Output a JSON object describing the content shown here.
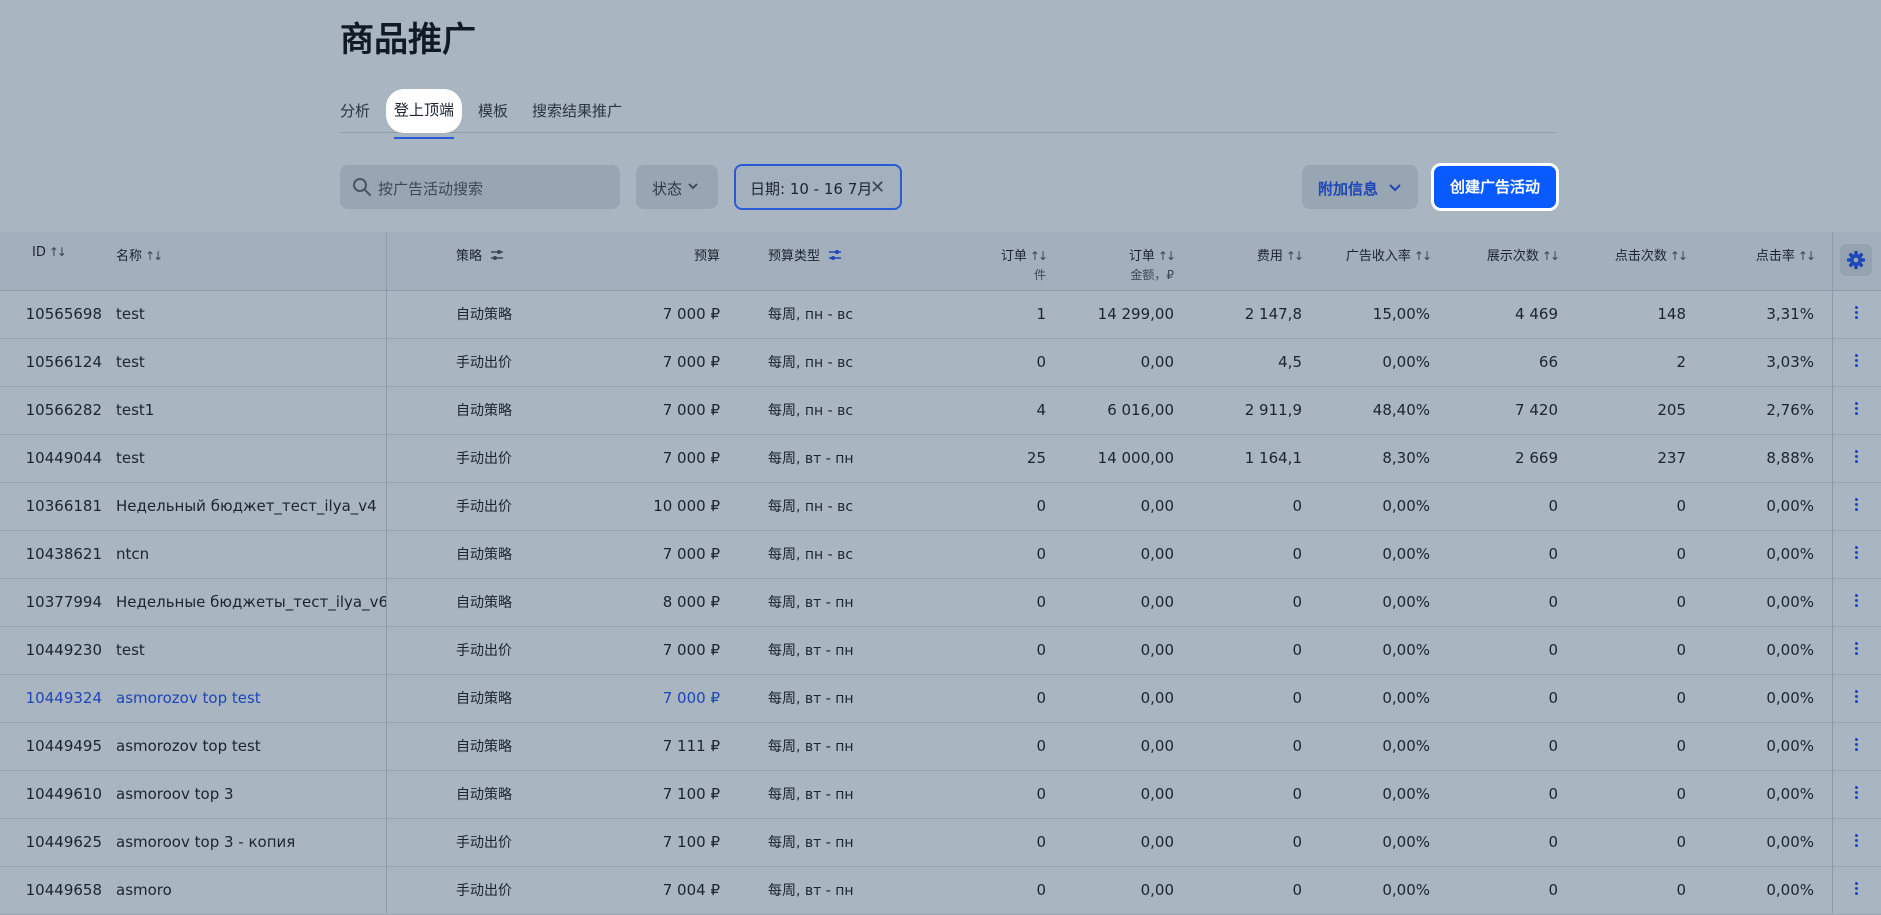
{
  "page": {
    "title": "商品推广"
  },
  "tabs": [
    {
      "label": "分析"
    },
    {
      "label": "登上顶端"
    },
    {
      "label": "模板"
    },
    {
      "label": "搜索结果推广"
    }
  ],
  "toolbar": {
    "search_placeholder": "按广告活动搜索",
    "status_label": "状态",
    "date_chip": "日期: 10 - 16 7月",
    "extra_info_label": "附加信息",
    "create_label": "创建广告活动"
  },
  "table": {
    "columns": [
      {
        "label": "ID"
      },
      {
        "label": "名称"
      },
      {
        "label": "策略"
      },
      {
        "label": "预算"
      },
      {
        "label": "预算类型"
      },
      {
        "label": "订单",
        "sub": "件"
      },
      {
        "label": "订单",
        "sub": "金额，₽"
      },
      {
        "label": "费用"
      },
      {
        "label": "广告收入率"
      },
      {
        "label": "展示次数"
      },
      {
        "label": "点击次数"
      },
      {
        "label": "点击率"
      }
    ],
    "rows": [
      {
        "id": "10565698",
        "name": "test",
        "strategy": "自动策略",
        "budget": "7 000 ₽",
        "budget_type": "每周, пн - вс",
        "orders": "1",
        "orders_sum": "14 299,00",
        "cost": "2 147,8",
        "ad_rate": "15,00%",
        "impressions": "4 469",
        "clicks": "148",
        "ctr": "3,31%"
      },
      {
        "id": "10566124",
        "name": "test",
        "strategy": "手动出价",
        "budget": "7 000 ₽",
        "budget_type": "每周, пн - вс",
        "orders": "0",
        "orders_sum": "0,00",
        "cost": "4,5",
        "ad_rate": "0,00%",
        "impressions": "66",
        "clicks": "2",
        "ctr": "3,03%"
      },
      {
        "id": "10566282",
        "name": "test1",
        "strategy": "自动策略",
        "budget": "7 000 ₽",
        "budget_type": "每周, пн - вс",
        "orders": "4",
        "orders_sum": "6 016,00",
        "cost": "2 911,9",
        "ad_rate": "48,40%",
        "impressions": "7 420",
        "clicks": "205",
        "ctr": "2,76%"
      },
      {
        "id": "10449044",
        "name": "test",
        "strategy": "手动出价",
        "budget": "7 000 ₽",
        "budget_type": "每周, вт - пн",
        "orders": "25",
        "orders_sum": "14 000,00",
        "cost": "1 164,1",
        "ad_rate": "8,30%",
        "impressions": "2 669",
        "clicks": "237",
        "ctr": "8,88%"
      },
      {
        "id": "10366181",
        "name": "Недельный бюджет_тест_ilya_v4",
        "strategy": "手动出价",
        "budget": "10 000 ₽",
        "budget_type": "每周, пн - вс",
        "orders": "0",
        "orders_sum": "0,00",
        "cost": "0",
        "ad_rate": "0,00%",
        "impressions": "0",
        "clicks": "0",
        "ctr": "0,00%"
      },
      {
        "id": "10438621",
        "name": "ntcn",
        "strategy": "自动策略",
        "budget": "7 000 ₽",
        "budget_type": "每周, пн - вс",
        "orders": "0",
        "orders_sum": "0,00",
        "cost": "0",
        "ad_rate": "0,00%",
        "impressions": "0",
        "clicks": "0",
        "ctr": "0,00%"
      },
      {
        "id": "10377994",
        "name": "Недельные бюджеты_тест_ilya_v6",
        "strategy": "自动策略",
        "budget": "8 000 ₽",
        "budget_type": "每周, вт - пн",
        "orders": "0",
        "orders_sum": "0,00",
        "cost": "0",
        "ad_rate": "0,00%",
        "impressions": "0",
        "clicks": "0",
        "ctr": "0,00%"
      },
      {
        "id": "10449230",
        "name": "test",
        "strategy": "手动出价",
        "budget": "7 000 ₽",
        "budget_type": "每周, вт - пн",
        "orders": "0",
        "orders_sum": "0,00",
        "cost": "0",
        "ad_rate": "0,00%",
        "impressions": "0",
        "clicks": "0",
        "ctr": "0,00%"
      },
      {
        "id": "10449324",
        "name": "asmorozov top test",
        "strategy": "自动策略",
        "budget": "7 000 ₽",
        "budget_type": "每周, вт - пн",
        "orders": "0",
        "orders_sum": "0,00",
        "cost": "0",
        "ad_rate": "0,00%",
        "impressions": "0",
        "clicks": "0",
        "ctr": "0,00%",
        "highlight": true
      },
      {
        "id": "10449495",
        "name": "asmorozov top test",
        "strategy": "自动策略",
        "budget": "7 111 ₽",
        "budget_type": "每周, вт - пн",
        "orders": "0",
        "orders_sum": "0,00",
        "cost": "0",
        "ad_rate": "0,00%",
        "impressions": "0",
        "clicks": "0",
        "ctr": "0,00%"
      },
      {
        "id": "10449610",
        "name": "asmoroov top 3",
        "strategy": "自动策略",
        "budget": "7 100 ₽",
        "budget_type": "每周, вт - пн",
        "orders": "0",
        "orders_sum": "0,00",
        "cost": "0",
        "ad_rate": "0,00%",
        "impressions": "0",
        "clicks": "0",
        "ctr": "0,00%"
      },
      {
        "id": "10449625",
        "name": "asmoroov top 3 - копия",
        "strategy": "手动出价",
        "budget": "7 100 ₽",
        "budget_type": "每周, вт - пн",
        "orders": "0",
        "orders_sum": "0,00",
        "cost": "0",
        "ad_rate": "0,00%",
        "impressions": "0",
        "clicks": "0",
        "ctr": "0,00%"
      },
      {
        "id": "10449658",
        "name": "asmoro",
        "strategy": "手动出价",
        "budget": "7 004 ₽",
        "budget_type": "每周, вт - пн",
        "orders": "0",
        "orders_sum": "0,00",
        "cost": "0",
        "ad_rate": "0,00%",
        "impressions": "0",
        "clicks": "0",
        "ctr": "0,00%"
      }
    ]
  },
  "colors": {
    "accent": "#0a5bff",
    "link": "#1d46b8",
    "background": "#a9b5c1"
  }
}
